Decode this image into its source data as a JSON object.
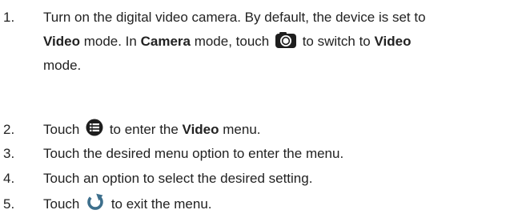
{
  "steps": [
    {
      "number": "1.",
      "line1": "Turn on the digital video camera. By default, the device is set to",
      "line2_bold1": "Video",
      "line2_text1": " mode. In ",
      "line2_bold2": "Camera",
      "line2_text2": " mode, touch ",
      "line2_text3": " to switch to ",
      "line2_bold3": "Video",
      "line3": "mode.",
      "icon": "camera-icon"
    },
    {
      "number": "2.",
      "text1": "Touch ",
      "text2": " to enter the ",
      "bold": "Video",
      "text3": " menu.",
      "icon": "menu-list-icon"
    },
    {
      "number": "3.",
      "text": "Touch the desired menu option to enter the menu."
    },
    {
      "number": "4.",
      "text": "Touch an option to select the desired setting."
    },
    {
      "number": "5.",
      "text1": "Touch ",
      "text2": " to exit the menu.",
      "icon": "back-arrow-icon"
    }
  ],
  "colors": {
    "text": "#222222",
    "icon_dark": "#1e1e1e",
    "icon_back": "#3d6f8c"
  }
}
